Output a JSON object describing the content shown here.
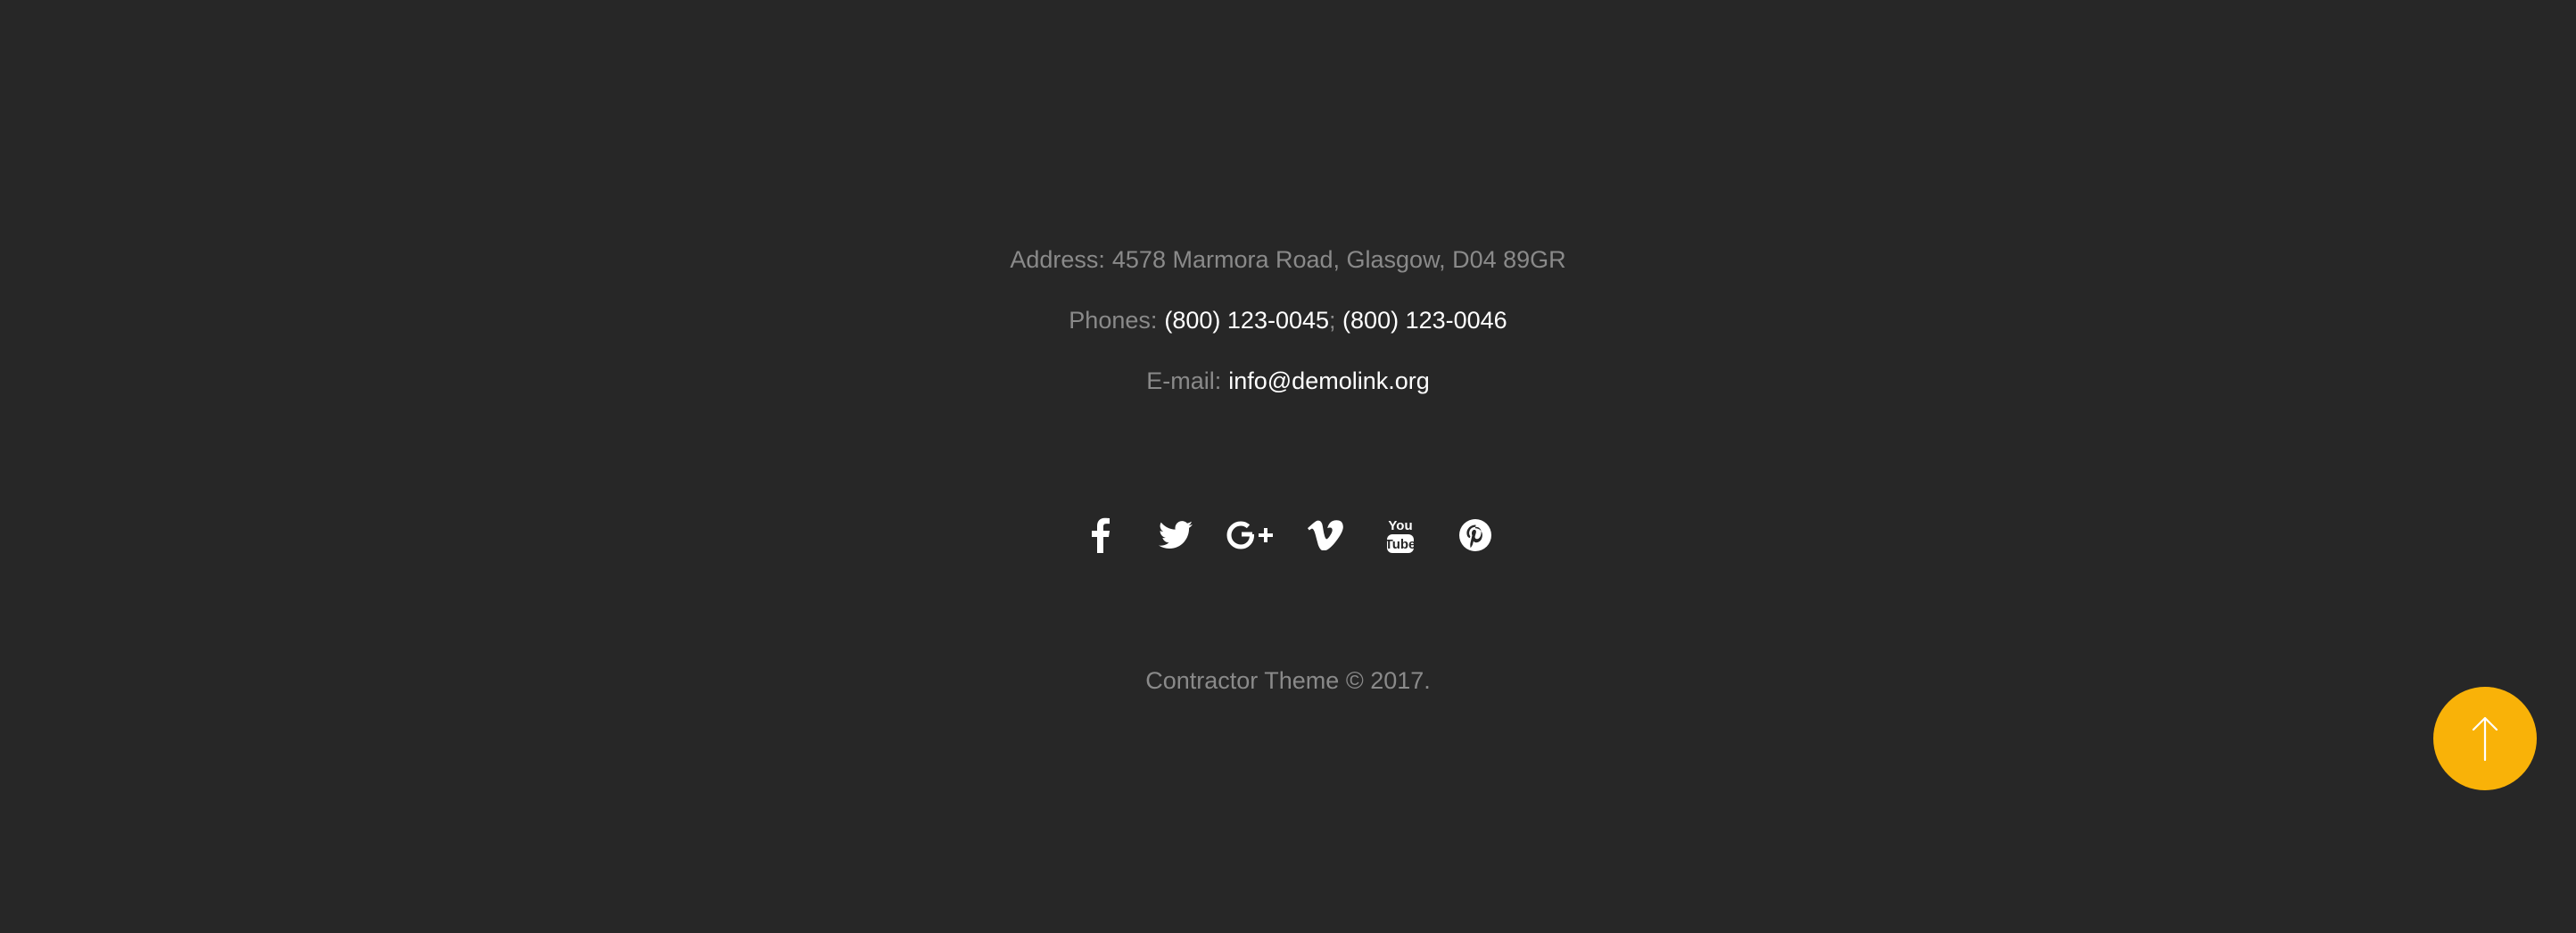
{
  "colors": {
    "background": "#272727",
    "muted_text": "#8a8a8a",
    "link_text": "#ffffff",
    "accent": "#f9b208"
  },
  "contact": {
    "address_label": "Address:",
    "address_value": "4578 Marmora Road, Glasgow, D04 89GR",
    "phones_label": "Phones:",
    "phone_1": "(800) 123-0045",
    "phone_separator": ";",
    "phone_2": "(800) 123-0046",
    "email_label": "E-mail:",
    "email_value": "info@demolink.org"
  },
  "socials": [
    {
      "icon": "facebook-icon"
    },
    {
      "icon": "twitter-icon"
    },
    {
      "icon": "google-plus-icon"
    },
    {
      "icon": "vimeo-icon"
    },
    {
      "icon": "youtube-icon"
    },
    {
      "icon": "pinterest-icon"
    }
  ],
  "copyright": "Contractor Theme © 2017.",
  "scroll_top": {
    "icon": "arrow-up-icon"
  }
}
